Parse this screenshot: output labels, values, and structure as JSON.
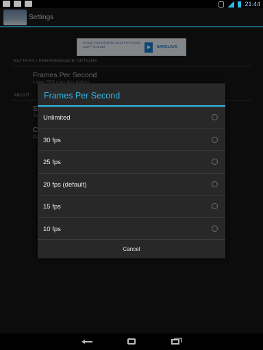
{
  "status_bar": {
    "time": "21:44",
    "icons": [
      "wifi-notification-icon",
      "image-notification-icon",
      "gmail-icon",
      "mute-icon",
      "signal-icon",
      "battery-icon"
    ]
  },
  "action_bar": {
    "title": "Settings",
    "app_icon": "app-icon"
  },
  "ad_banner": {
    "text": "Picture yourself at the 2014 FIFA World Cup™ in Brazil",
    "brand": "BARCLAYS"
  },
  "sections": [
    {
      "header": "BATTERY / PERFORMANCE OPTIONS",
      "items": [
        {
          "title": "Frames Per Second",
          "summary": "Lower FPS uses less battery"
        }
      ]
    },
    {
      "header": "ABOUT",
      "items": [
        {
          "title": "S",
          "summary": "Te"
        },
        {
          "title": "C",
          "summary": "Co"
        }
      ]
    }
  ],
  "dialog": {
    "title": "Frames Per Second",
    "options": [
      {
        "label": "Unlimited"
      },
      {
        "label": "30 fps"
      },
      {
        "label": "25 fps"
      },
      {
        "label": "20 fps (default)"
      },
      {
        "label": "15 fps"
      },
      {
        "label": "10 fps"
      }
    ],
    "cancel_label": "Cancel"
  },
  "nav_bar": {
    "buttons": [
      "back-icon",
      "home-icon",
      "recent-apps-icon"
    ]
  },
  "colors": {
    "accent": "#33b5e5",
    "dialog_bg": "#282828"
  }
}
